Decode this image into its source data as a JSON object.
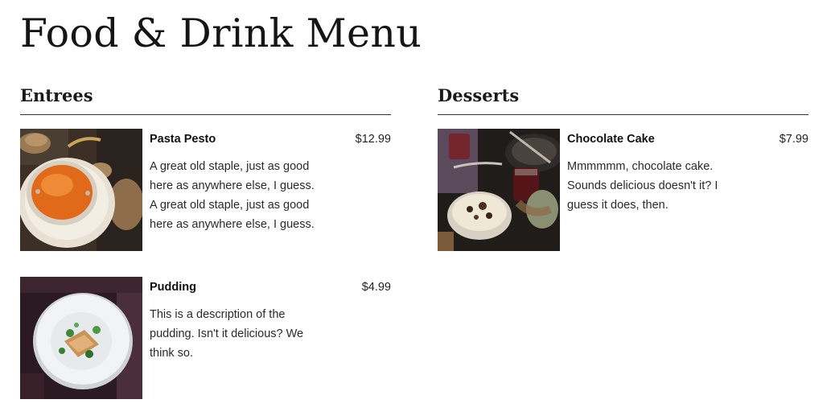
{
  "page": {
    "title": "Food & Drink Menu"
  },
  "sections": [
    {
      "heading": "Entrees",
      "items": [
        {
          "name": "Pasta Pesto",
          "price": "$12.99",
          "description": "A great old staple, just as good here as anywhere else, I guess. A great old staple, just as good here as anywhere else, I guess."
        },
        {
          "name": "Pudding",
          "price": "$4.99",
          "description": "This is a description of the pudding. Isn't it delicious? We think so."
        }
      ]
    },
    {
      "heading": "Desserts",
      "items": [
        {
          "name": "Chocolate Cake",
          "price": "$7.99",
          "description": "Mmmmmm, chocolate cake. Sounds delicious doesn't it? I guess it does, then."
        }
      ]
    }
  ]
}
